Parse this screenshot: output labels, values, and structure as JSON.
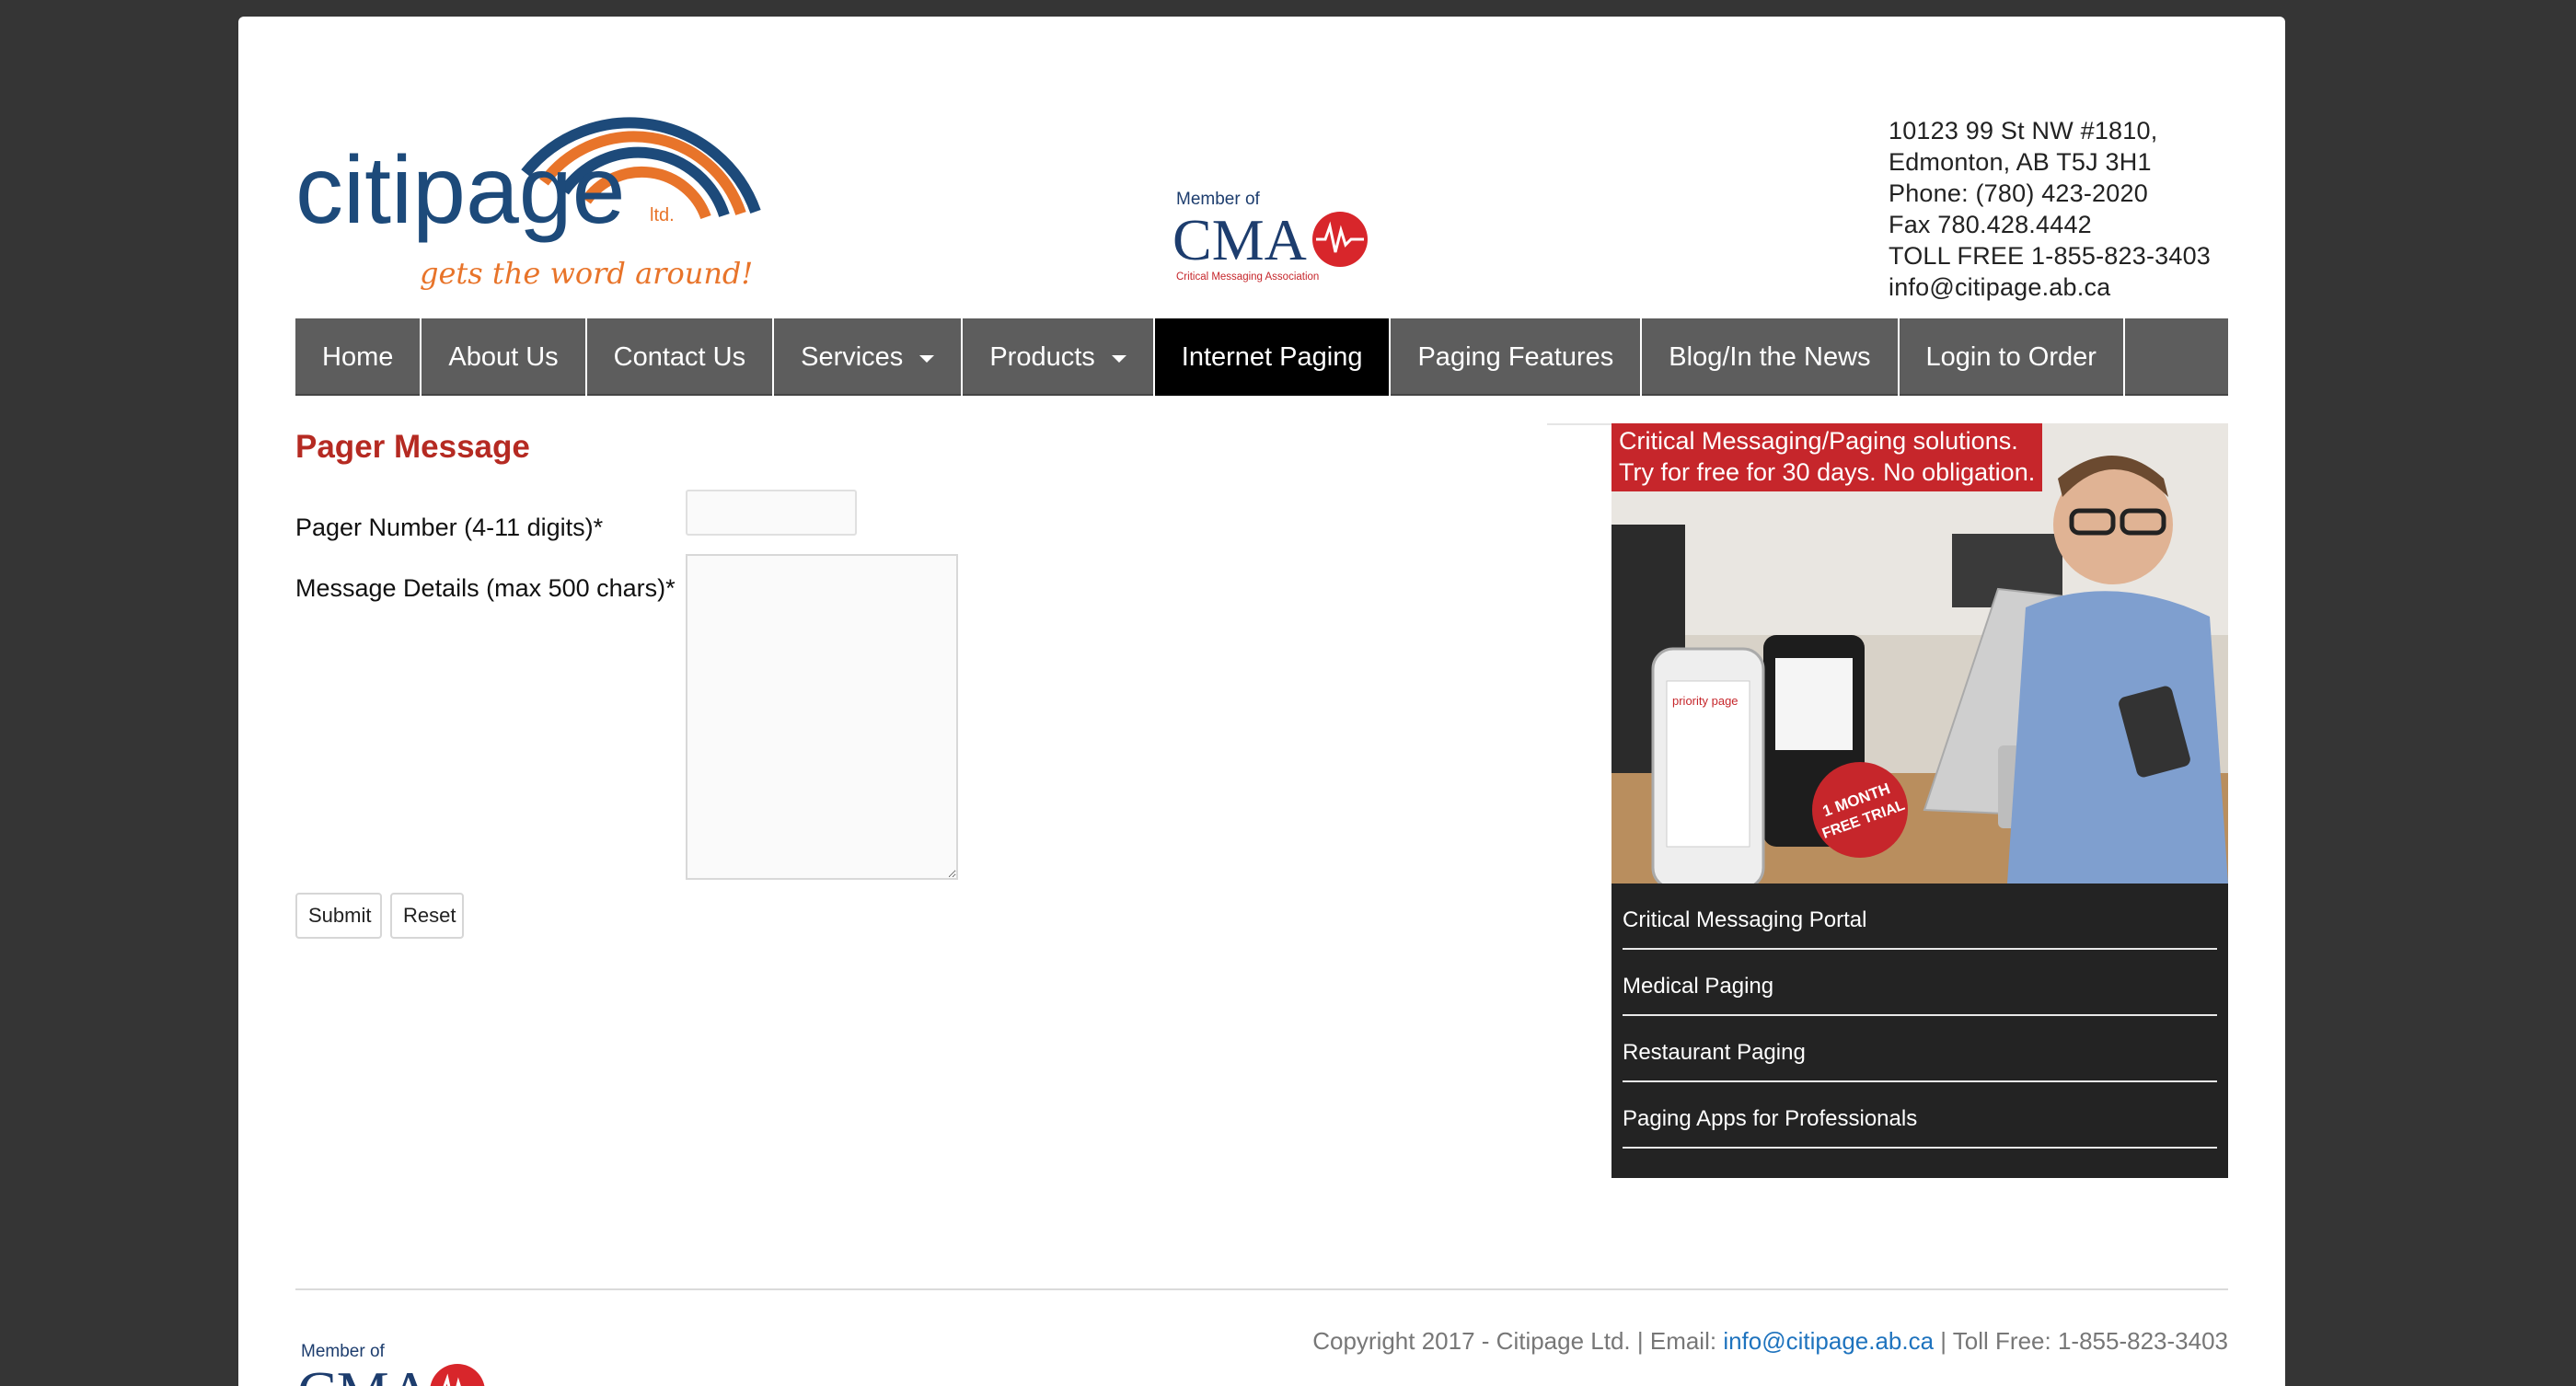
{
  "brand": {
    "logo_word": "citipage",
    "logo_ltd": "ltd.",
    "logo_tagline": "gets the word around!",
    "colors": {
      "navy": "#1d4a7a",
      "orange": "#e8742a",
      "red": "#c6262b"
    }
  },
  "cma_badge": {
    "member_of": "Member of",
    "acronym": "CMA",
    "full_name": "Critical Messaging Association"
  },
  "address": {
    "line1": "10123 99 St NW #1810,",
    "line2": "Edmonton, AB T5J 3H1",
    "phone": "Phone: (780) 423-2020",
    "fax": "Fax 780.428.4442",
    "toll_free": "TOLL FREE 1-855-823-3403",
    "email": "info@citipage.ab.ca"
  },
  "nav": {
    "items": [
      {
        "label": "Home"
      },
      {
        "label": "About Us"
      },
      {
        "label": "Contact Us"
      },
      {
        "label": "Services"
      },
      {
        "label": "Products"
      },
      {
        "label": "Internet Paging"
      },
      {
        "label": "Paging Features"
      },
      {
        "label": "Blog/In the News"
      },
      {
        "label": "Login to Order"
      }
    ]
  },
  "form": {
    "title": "Pager Message",
    "pager_label": "Pager Number (4-11 digits)*",
    "pager_value": "",
    "message_label": "Message Details (max 500 chars)*",
    "message_value": "",
    "submit_label": "Submit",
    "reset_label": "Reset"
  },
  "promo": {
    "banner_line1": "Critical Messaging/Paging solutions.",
    "banner_line2": "Try for free for 30 days. No obligation.",
    "phone_brand": "priority page",
    "sticker_line1": "1 MONTH",
    "sticker_line2": "FREE TRIAL"
  },
  "sidebar": {
    "links": [
      {
        "label": "Critical Messaging Portal"
      },
      {
        "label": "Medical Paging"
      },
      {
        "label": "Restaurant Paging"
      },
      {
        "label": "Paging Apps for Professionals"
      }
    ]
  },
  "footer": {
    "copyright_prefix": "Copyright 2017 - Citipage Ltd. | Email: ",
    "email": "info@citipage.ab.ca",
    "toll_free": " | Toll Free: 1-855-823-3403"
  }
}
